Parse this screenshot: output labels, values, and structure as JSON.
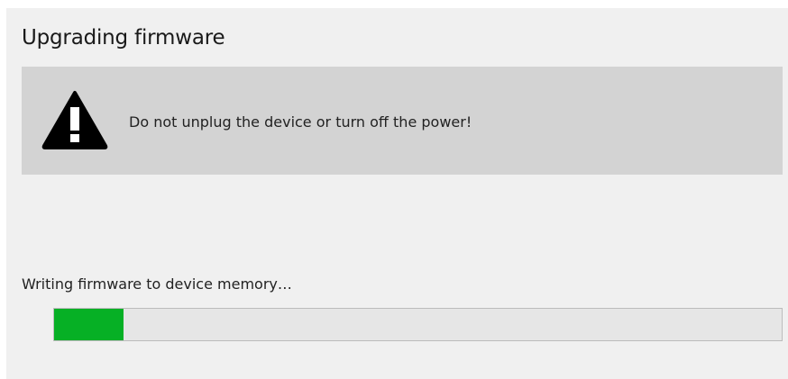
{
  "dialog": {
    "title": "Upgrading firmware"
  },
  "warning": {
    "icon": "warning-triangle-icon",
    "message": "Do not unplug the device or turn off the power!"
  },
  "status": {
    "text": "Writing firmware to device memory…"
  },
  "progress": {
    "percent": 9.6,
    "fill_color": "#06b025",
    "track_color": "#e6e6e6"
  }
}
